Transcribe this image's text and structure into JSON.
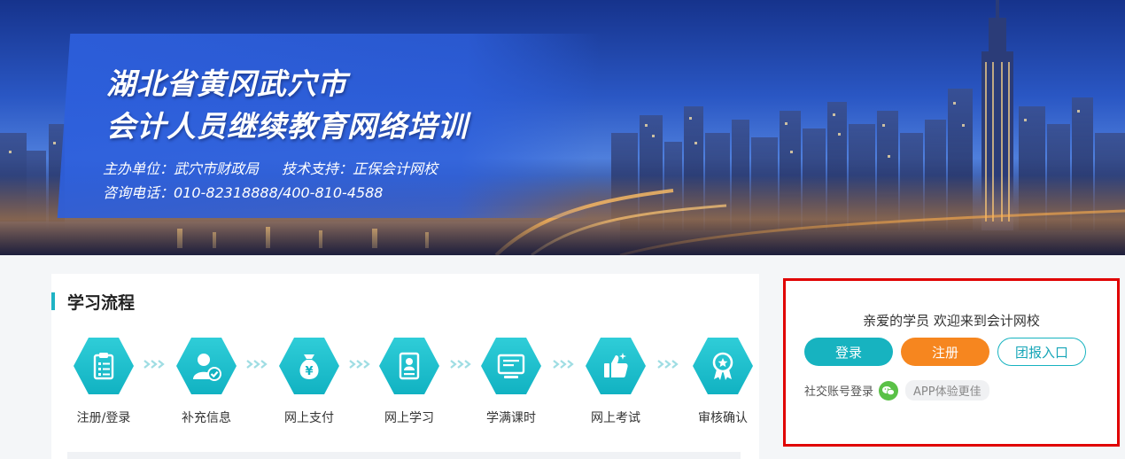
{
  "banner": {
    "title_line1": "湖北省黄冈武穴市",
    "title_line2": "会计人员继续教育网络培训",
    "organizer": "主办单位：武穴市财政局",
    "tech_support": "技术支持：正保会计网校",
    "hotline": "咨询电话：010-82318888/400-810-4588"
  },
  "process": {
    "title": "学习流程",
    "steps": [
      {
        "label": "注册/登录",
        "icon": "clipboard-icon"
      },
      {
        "label": "补充信息",
        "icon": "user-check-icon"
      },
      {
        "label": "网上支付",
        "icon": "money-bag-icon"
      },
      {
        "label": "网上学习",
        "icon": "document-user-icon"
      },
      {
        "label": "学满课时",
        "icon": "monitor-icon"
      },
      {
        "label": "网上考试",
        "icon": "thumbs-up-icon"
      },
      {
        "label": "审核确认",
        "icon": "badge-icon"
      }
    ]
  },
  "login": {
    "welcome": "亲爱的学员 欢迎来到会计网校",
    "login_label": "登录",
    "register_label": "注册",
    "group_label": "团报入口",
    "social_label": "社交账号登录",
    "app_label": "APP体验更佳"
  },
  "colors": {
    "accent": "#17b3c0",
    "orange": "#f6861f",
    "highlight_border": "#e00000"
  }
}
